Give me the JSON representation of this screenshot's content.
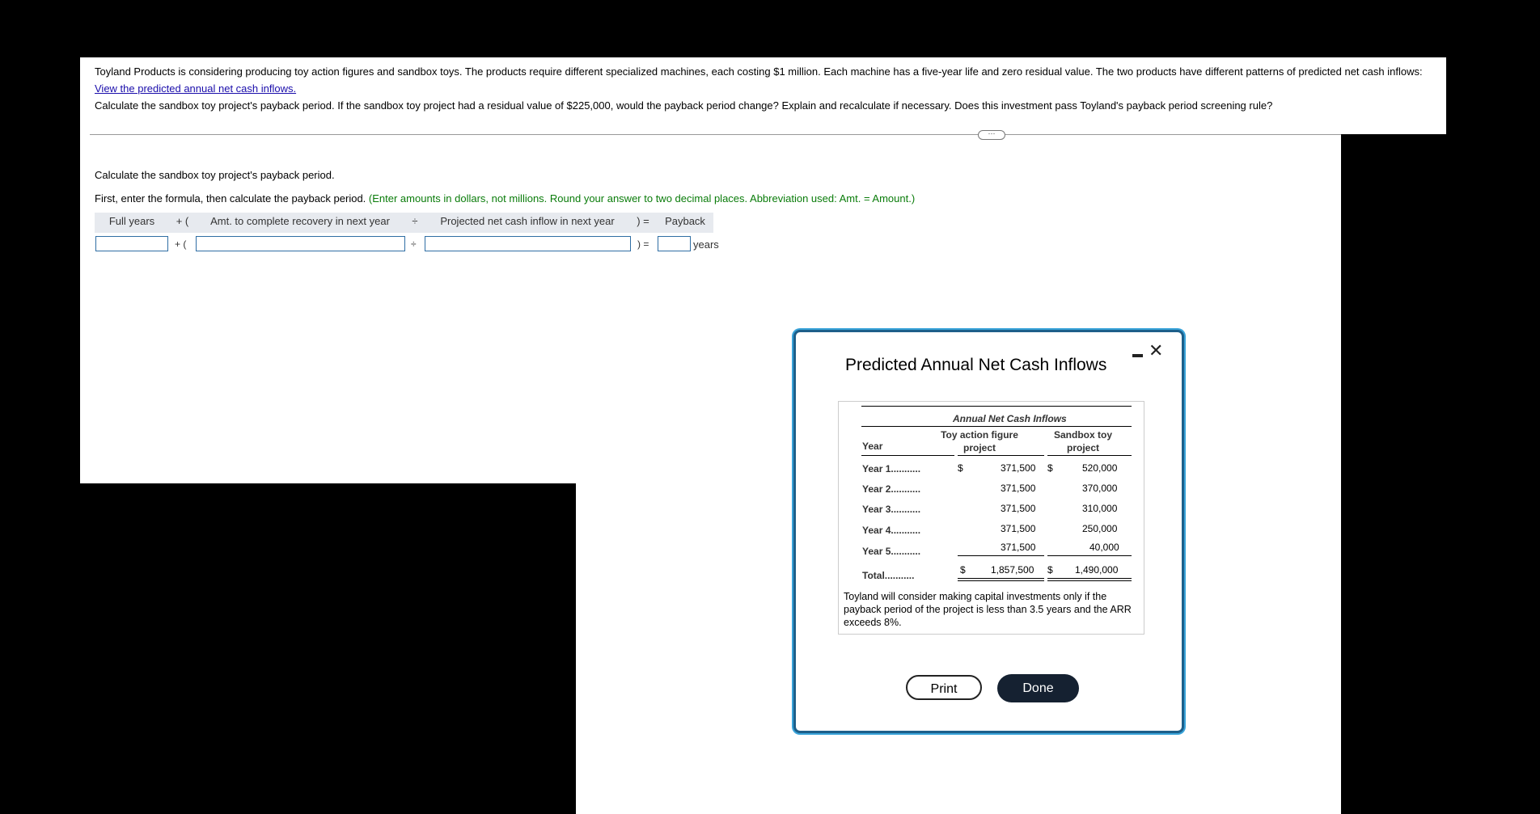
{
  "problem": {
    "intro": "Toyland Products is considering producing toy action figures and sandbox toys. The products require different specialized machines, each costing $1 million. Each machine has a five-year life and zero residual value. The two products have different patterns of predicted net cash inflows:",
    "link": "View the predicted annual net cash inflows.",
    "question": "Calculate the sandbox toy project's payback period. If the sandbox toy project had a residual value of $225,000, would the payback period change? Explain and recalculate if necessary. Does this investment pass Toyland's payback period screening rule?"
  },
  "more_button": "···",
  "part": {
    "heading": "Calculate the sandbox toy project's payback period.",
    "instruction": "First, enter the formula, then calculate the payback period.",
    "hint": "(Enter amounts in dollars, not millions. Round your answer to two decimal places. Abbreviation used: Amt. = Amount.)"
  },
  "formula": {
    "full_years": "Full years",
    "plus_open": "+ (",
    "amt_recovery": "Amt. to complete recovery in next year",
    "divide": "÷",
    "projected_inflow": "Projected net cash inflow in next year",
    "close_eq": ") =",
    "payback": "Payback",
    "years_unit": "years"
  },
  "modal": {
    "title": "Predicted Annual Net Cash Inflows",
    "table_header": "Annual Net Cash Inflows",
    "col_year": "Year",
    "col1_line1": "Toy action figure",
    "col1_line2": "project",
    "col2_line1": "Sandbox toy",
    "col2_line2": "project",
    "rows": [
      {
        "label": "Year 1",
        "dots": "...........",
        "c1_sign": "$",
        "c1": "371,500",
        "c2_sign": "$",
        "c2": "520,000"
      },
      {
        "label": "Year 2",
        "dots": "...........",
        "c1": "371,500",
        "c2": "370,000"
      },
      {
        "label": "Year 3",
        "dots": "...........",
        "c1": "371,500",
        "c2": "310,000"
      },
      {
        "label": "Year 4",
        "dots": "...........",
        "c1": "371,500",
        "c2": "250,000"
      },
      {
        "label": "Year 5",
        "dots": "...........",
        "c1": "371,500",
        "c2": "40,000"
      }
    ],
    "total": {
      "label": "Total",
      "dots": "...........",
      "c1_sign": "$",
      "c1": "1,857,500",
      "c2_sign": "$",
      "c2": "1,490,000"
    },
    "note": "Toyland will consider making capital investments only if the payback period of the project is less than 3.5 years and the ARR exceeds 8%.",
    "print_label": "Print",
    "done_label": "Done"
  }
}
